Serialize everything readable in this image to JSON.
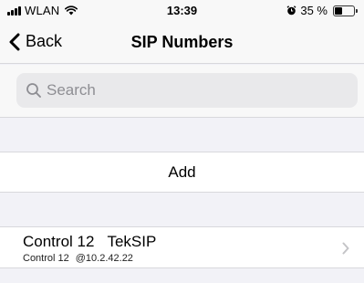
{
  "status": {
    "carrier": "WLAN",
    "time": "13:39",
    "battery": "35 %",
    "battery_level": 0.35
  },
  "nav": {
    "back_label": "Back",
    "title": "SIP Numbers"
  },
  "search": {
    "placeholder": "Search"
  },
  "add": {
    "label": "Add"
  },
  "items": [
    {
      "name": "Control 12",
      "type": "TekSIP",
      "subtitle_name": "Control 12",
      "subtitle_address": "@10.2.42.22"
    }
  ]
}
